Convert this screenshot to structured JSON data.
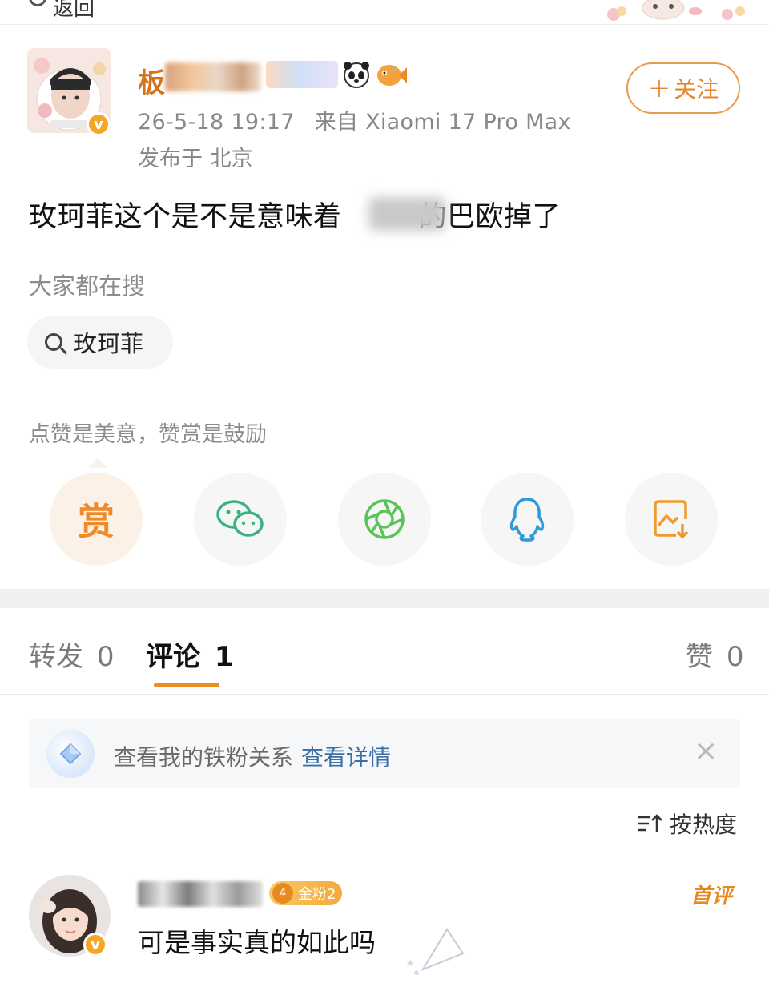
{
  "top_bar": {
    "back_label": "返回"
  },
  "post": {
    "author": {
      "name_visible": "板",
      "badge_count": 3
    },
    "time": "26-5-18 19:17",
    "source_prefix": "来自",
    "device": "Xiaomi 17 Pro Max",
    "location": "发布于 北京",
    "follow_label": "+关注",
    "follow_plus": "+",
    "follow_text": "关注",
    "text_before": "玫珂菲这个是不是意味着",
    "text_after": "的巴欧掉了"
  },
  "search": {
    "hint": "大家都在搜",
    "chip": "玫珂菲"
  },
  "reward": {
    "hint": "点赞是美意，赞赏是鼓励",
    "reward_glyph": "赏",
    "actions": [
      "reward",
      "wechat",
      "moments",
      "qq",
      "save-image"
    ]
  },
  "tabs": {
    "repost": {
      "label": "转发",
      "count": "0"
    },
    "comment": {
      "label": "评论",
      "count": "1"
    },
    "like": {
      "label": "赞",
      "count": "0"
    }
  },
  "fan_bar": {
    "text": "查看我的铁粉关系",
    "link": "查看详情",
    "close": "×"
  },
  "sort": {
    "label": "按热度"
  },
  "comment": {
    "badge": "金粉2",
    "badge_level": "4",
    "first_label": "首评",
    "text": "可是事实真的如此吗"
  },
  "colors": {
    "accent_orange": "#e3862c",
    "link_blue": "#3b6fa8",
    "wechat_green": "#36b37e",
    "qq_blue": "#2e9bd6",
    "verify_orange": "#f5a623"
  }
}
